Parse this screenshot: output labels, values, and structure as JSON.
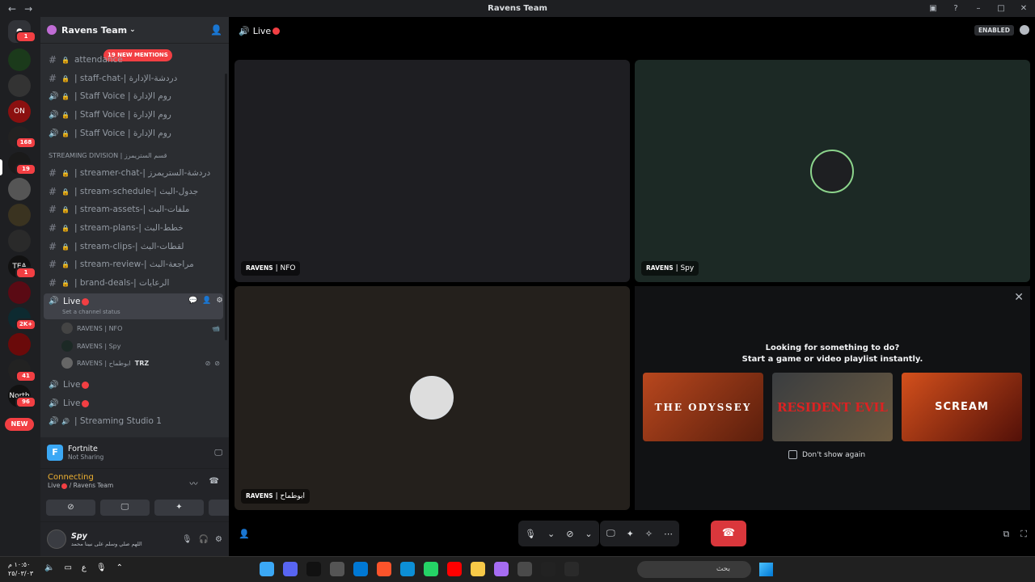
{
  "window": {
    "title": "Ravens Team",
    "nav_back": "←",
    "nav_fwd": "→"
  },
  "guilds": {
    "badges": [
      "1",
      "168",
      "19",
      "1",
      "2K+",
      "41",
      "96"
    ],
    "labels": [
      "ON",
      "TEA",
      "North"
    ],
    "new_label": "NEW"
  },
  "server": {
    "name": "Ravens Team",
    "mentions": "19 NEW MENTIONS",
    "category": "STREAMING DIVISION | قسم الستريمرز",
    "channels": [
      {
        "name": "attendance"
      },
      {
        "name": "| staff-chat-| دردشة-الإدارة"
      },
      {
        "name": "| Staff Voice | روم الإدارة"
      },
      {
        "name": "| Staff Voice | روم الإدارة"
      },
      {
        "name": "| Staff Voice | روم الإدارة"
      },
      {
        "name": "| streamer-chat-| دردشة-الستريمرز"
      },
      {
        "name": "| stream-schedule-| جدول-البث"
      },
      {
        "name": "| stream-assets-| ملفات-البث"
      },
      {
        "name": "| stream-plans-| خطط-البث"
      },
      {
        "name": "| stream-clips-| لقطات-البث"
      },
      {
        "name": "| stream-review-| مراجعة-البث"
      },
      {
        "name": "| brand-deals-| الرعايات"
      }
    ],
    "live_channel": {
      "name": "Live",
      "status": "Set a channel status"
    },
    "voice_users": [
      {
        "name": "RAVENS | NFO"
      },
      {
        "name": "RAVENS | Spy"
      },
      {
        "name": "RAVENS | ابوطماح",
        "tag": "TRZ"
      }
    ],
    "more_channels": [
      "Live",
      "Live",
      "| Streaming Studio 1"
    ]
  },
  "activity": {
    "game": "Fortnite",
    "status": "Not Sharing"
  },
  "connection": {
    "status": "Connecting",
    "channel": "Live",
    "server": "/ Ravens Team"
  },
  "user": {
    "name": "Spy",
    "status": "اللهم صلي وسلم على نبينا محمد"
  },
  "stage": {
    "channel": "Live",
    "enabled": "ENABLED",
    "tiles": [
      {
        "label_prefix": "RAVENS",
        "label": "| NFO",
        "bg": "#1e1e22"
      },
      {
        "label_prefix": "RAVENS",
        "label": "| Spy",
        "bg": "#1c2925"
      },
      {
        "label_prefix": "RAVENS",
        "label": "| ابوطماح",
        "bg": "#24201c"
      }
    ],
    "prompt_line1": "Looking for something to do?",
    "prompt_line2": "Start a game or video playlist instantly.",
    "cards": [
      "THE ODYSSEY",
      "RESIDENT EVIL",
      "SCREAM"
    ],
    "dont_show": "Don't show again"
  },
  "taskbar": {
    "time": "١٠:٥٠ م",
    "date": "٢٥/٠٣/٠٣",
    "lang": "ع",
    "search": "بحث"
  },
  "colors": {
    "accent": "#5865f2",
    "danger": "#f23f43",
    "warning": "#f0b232"
  }
}
